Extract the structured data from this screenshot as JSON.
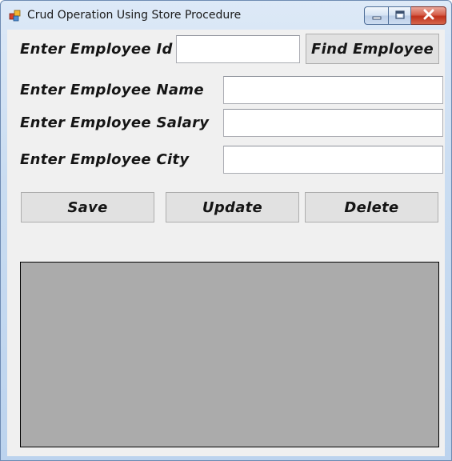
{
  "window": {
    "title": "Crud Operation Using Store Procedure",
    "icon": "form-app-icon",
    "caption_buttons": [
      "minimize-icon",
      "maximize-icon",
      "close-icon"
    ]
  },
  "form": {
    "id_label": "Enter Employee Id",
    "id_value": "",
    "find_button": "Find Employee",
    "name_label": "Enter Employee Name",
    "name_value": "",
    "salary_label": "Enter Employee Salary",
    "salary_value": "",
    "city_label": "Enter Employee City",
    "city_value": ""
  },
  "actions": {
    "save": "Save",
    "update": "Update",
    "delete": "Delete"
  },
  "colors": {
    "client_background": "#f0f0f0",
    "grid_background": "#ababab",
    "close_button": "#c0311b"
  }
}
